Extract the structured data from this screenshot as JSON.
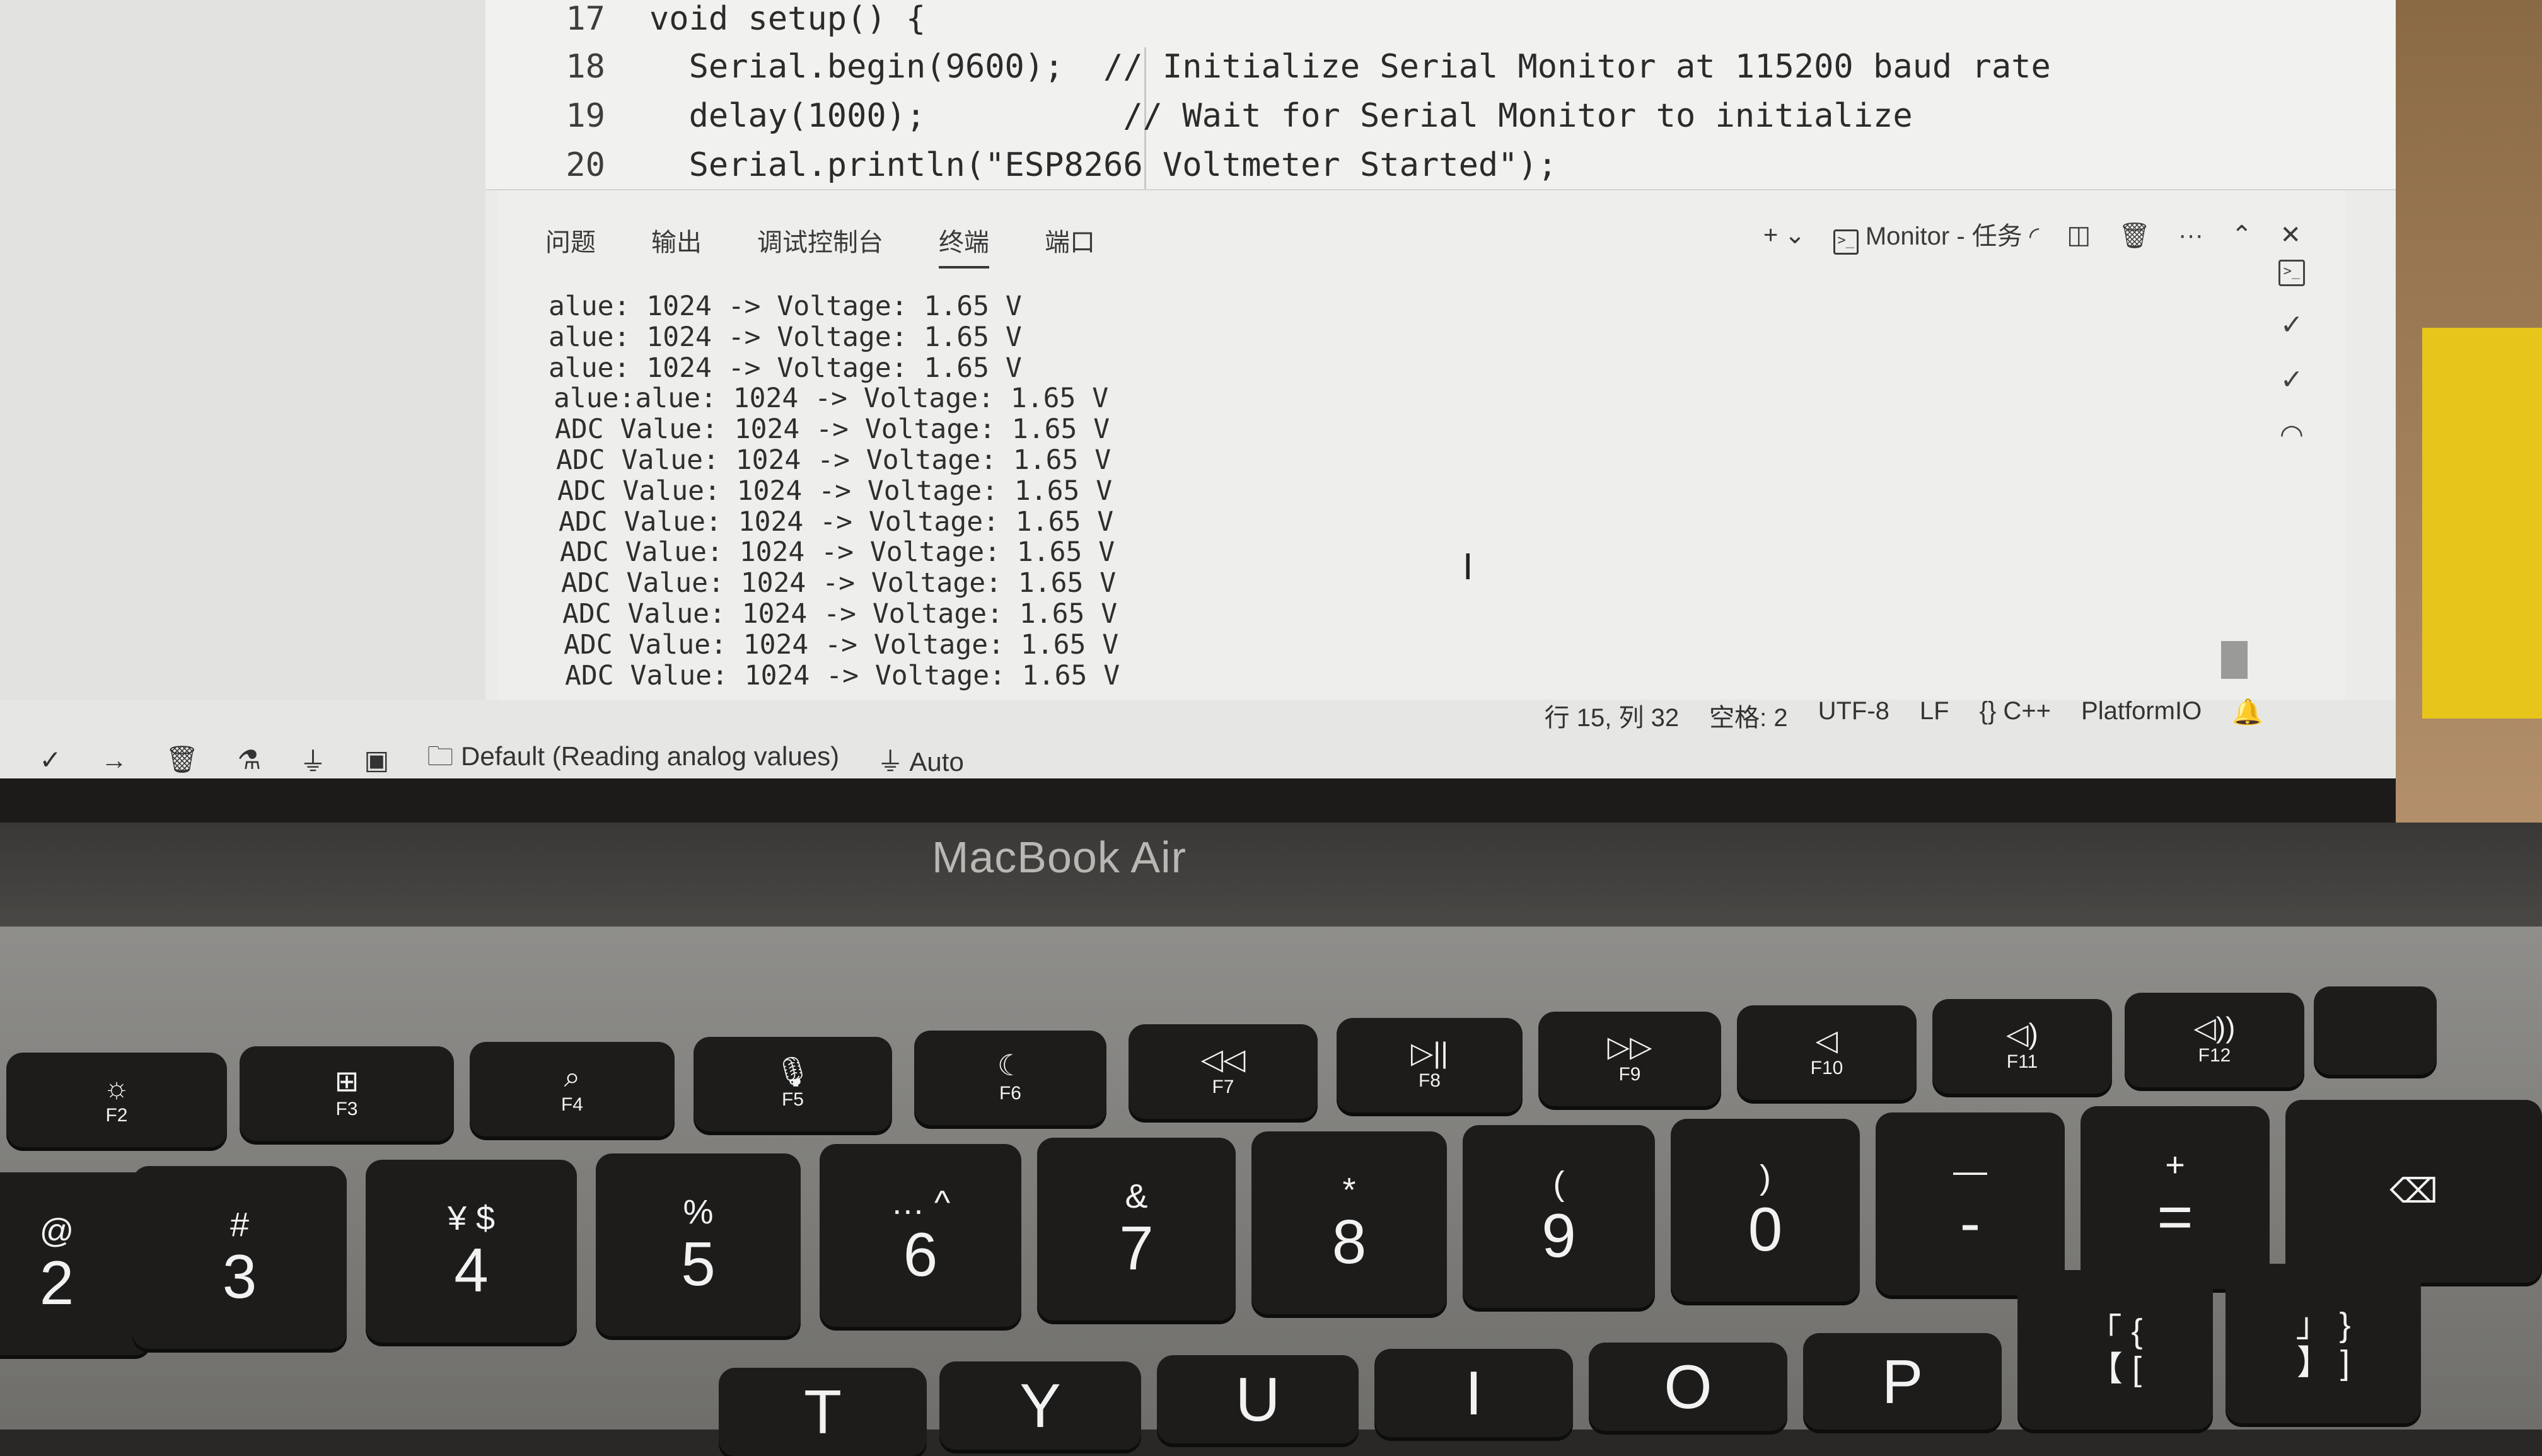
{
  "editor": {
    "lines": [
      {
        "num": "17",
        "code": "void setup() {"
      },
      {
        "num": "18",
        "code": "  Serial.begin(9600);  // Initialize Serial Monitor at 115200 baud rate"
      },
      {
        "num": "19",
        "code": "  delay(1000);          // Wait for Serial Monitor to initialize"
      },
      {
        "num": "20",
        "code": "  Serial.println(\"ESP8266 Voltmeter Started\");"
      }
    ]
  },
  "panel": {
    "tabs": [
      "问题",
      "输出",
      "调试控制台",
      "终端",
      "端口"
    ],
    "active_tab": "终端",
    "monitor_label": "Monitor - 任务",
    "actions": {
      "add": "+",
      "dropdown": "⌄",
      "split": "◫",
      "trash": "🗑",
      "more": "···",
      "maximize": "⌃",
      "close": "✕"
    },
    "terminal_lines": [
      "alue: 1024 -> Voltage: 1.65 V",
      "alue: 1024 -> Voltage: 1.65 V",
      "alue: 1024 -> Voltage: 1.65 V",
      "alue:alue: 1024 -> Voltage: 1.65 V",
      "ADC Value: 1024 -> Voltage: 1.65 V",
      "ADC Value: 1024 -> Voltage: 1.65 V",
      "ADC Value: 1024 -> Voltage: 1.65 V",
      "ADC Value: 1024 -> Voltage: 1.65 V",
      "ADC Value: 1024 -> Voltage: 1.65 V",
      "ADC Value: 1024 -> Voltage: 1.65 V",
      "ADC Value: 1024 -> Voltage: 1.65 V",
      "ADC Value: 1024 -> Voltage: 1.65 V",
      "ADC Value: 1024 -> Voltage: 1.65 V"
    ]
  },
  "status_bar": {
    "position": "行 15, 列 32",
    "spaces": "空格: 2",
    "encoding": "UTF-8",
    "eol": "LF",
    "language": "{} C++",
    "platform": "PlatformIO",
    "environment": "Default (Reading analog values)",
    "port": "Auto"
  },
  "laptop": {
    "brand": "MacBook Air"
  },
  "keyboard": {
    "fn_keys": [
      {
        "icon": "☼",
        "label": "F2"
      },
      {
        "icon": "⊞",
        "label": "F3"
      },
      {
        "icon": "⌕",
        "label": "F4"
      },
      {
        "icon": "🎙",
        "label": "F5"
      },
      {
        "icon": "☾",
        "label": "F6"
      },
      {
        "icon": "◁◁",
        "label": "F7"
      },
      {
        "icon": "▷||",
        "label": "F8"
      },
      {
        "icon": "▷▷",
        "label": "F9"
      },
      {
        "icon": "◁",
        "label": "F10"
      },
      {
        "icon": "◁)",
        "label": "F11"
      },
      {
        "icon": "◁))",
        "label": "F12"
      }
    ],
    "number_keys": [
      {
        "sym": "@",
        "main": "2"
      },
      {
        "sym": "#",
        "main": "3"
      },
      {
        "sym": "¥  $",
        "main": "4"
      },
      {
        "sym": "%",
        "main": "5"
      },
      {
        "sym": "…  ^",
        "main": "6"
      },
      {
        "sym": "&",
        "main": "7"
      },
      {
        "sym": "*",
        "main": "8"
      },
      {
        "sym": "(",
        "main": "9"
      },
      {
        "sym": ")",
        "main": "0"
      },
      {
        "sym": "—",
        "main": "-"
      },
      {
        "sym": "+",
        "main": "="
      },
      {
        "sym": "⌫",
        "main": ""
      }
    ],
    "letter_keys": [
      {
        "sym": "",
        "main": "T"
      },
      {
        "sym": "",
        "main": "Y"
      },
      {
        "sym": "",
        "main": "U"
      },
      {
        "sym": "",
        "main": "I"
      },
      {
        "sym": "",
        "main": "O"
      },
      {
        "sym": "",
        "main": "P"
      },
      {
        "sym": "「 {",
        "main": "【 ["
      },
      {
        "sym": "」 }",
        "main": "】 ]"
      }
    ]
  }
}
